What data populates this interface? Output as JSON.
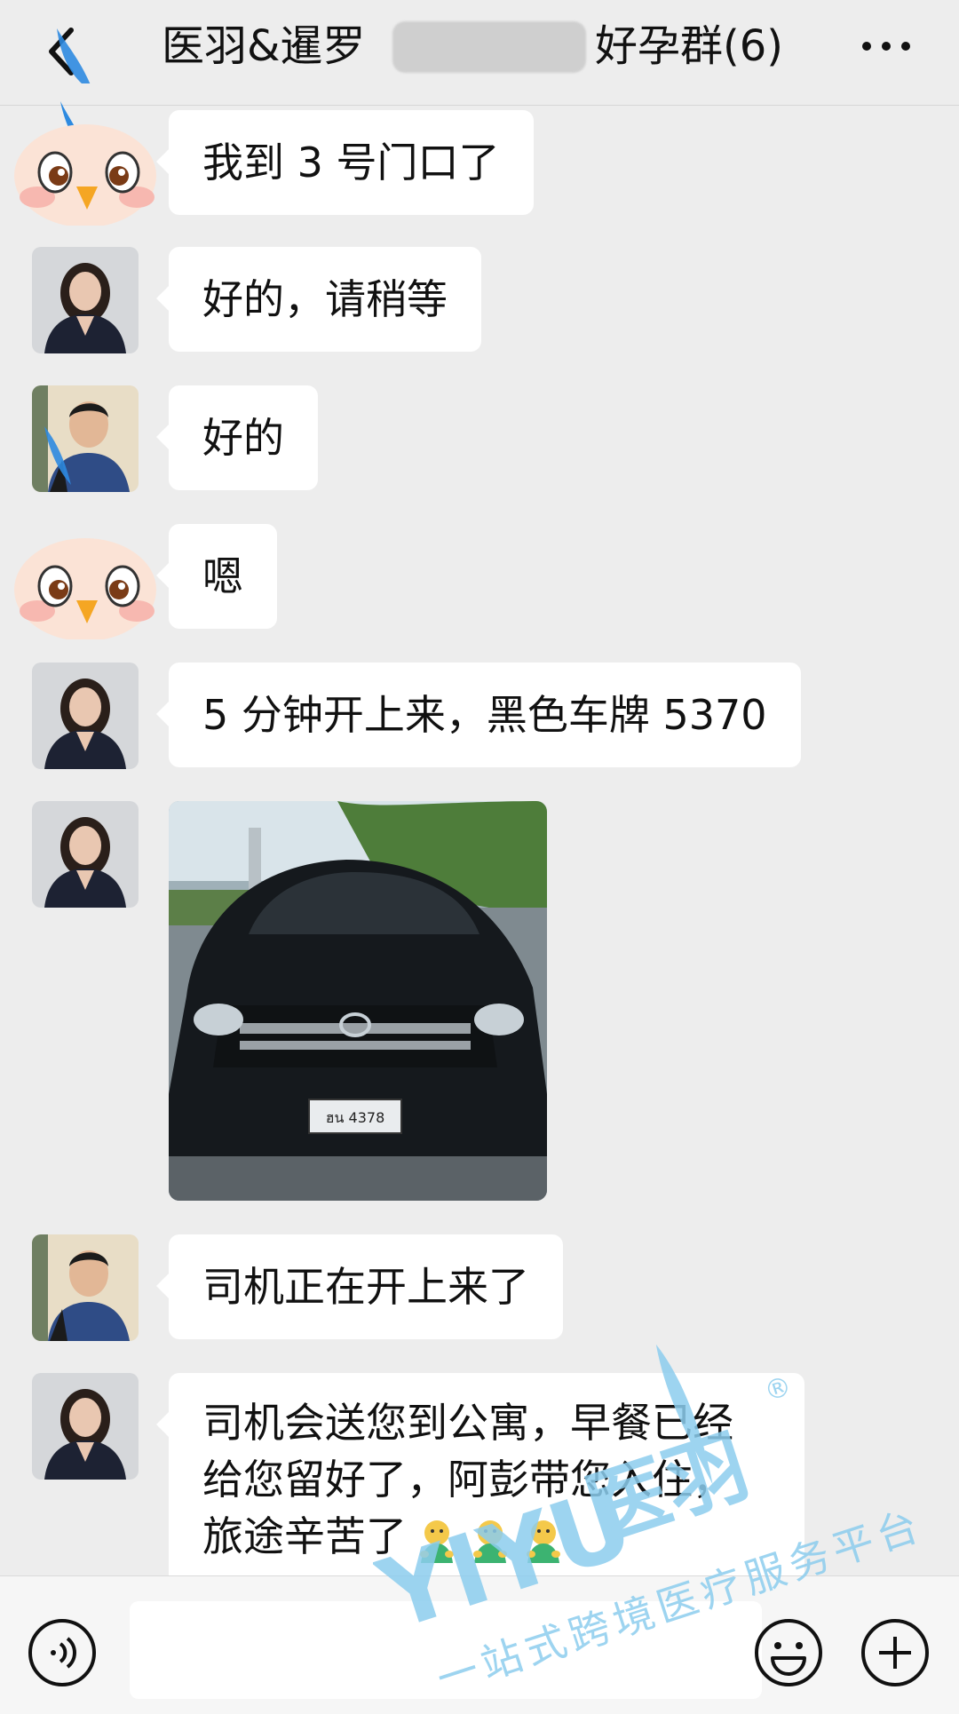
{
  "header": {
    "title": "医羽&暹罗",
    "title_suffix": "好孕群(6)"
  },
  "messages": [
    {
      "sender": "bird",
      "text": "我到 3 号门口了"
    },
    {
      "sender": "woman",
      "text": "好的，请稍等"
    },
    {
      "sender": "man",
      "text": "好的"
    },
    {
      "sender": "bird",
      "text": "嗯"
    },
    {
      "sender": "woman",
      "text": "5 分钟开上来，黑色车牌 5370"
    },
    {
      "sender": "woman",
      "type": "image",
      "plate_text": "ฮน 4378"
    },
    {
      "sender": "man",
      "text": "司机正在开上来了"
    },
    {
      "sender": "woman",
      "lines": [
        "司机会送您到公寓，早餐已经",
        "给您留好了，阿彭带您入住，",
        "旅途辛苦了"
      ],
      "emoji_count": 3
    }
  ],
  "watermark": {
    "brand_latin": "YIYU",
    "brand_cn": "医羽",
    "tagline": "一站式跨境医疗服务平台",
    "registered": "®"
  },
  "colors": {
    "background": "#ededed",
    "bubble": "#ffffff",
    "watermark": "#8ccdee"
  },
  "icons": {
    "back": "back-chevron-icon",
    "more": "more-dots-icon",
    "voice": "voice-icon",
    "emoji": "emoji-icon",
    "plus": "plus-icon"
  }
}
